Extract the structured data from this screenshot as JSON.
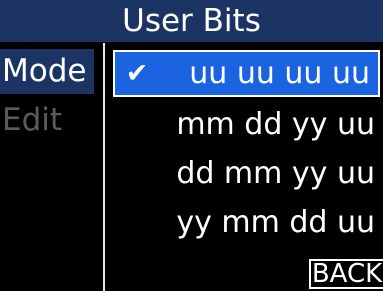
{
  "header": {
    "title": "User Bits"
  },
  "sidebar": {
    "items": [
      {
        "label": "Mode",
        "selected": true
      },
      {
        "label": "Edit",
        "selected": false
      }
    ]
  },
  "list": {
    "options": [
      {
        "label": "uu uu uu uu",
        "checked": true
      },
      {
        "label": "mm dd yy uu",
        "checked": false
      },
      {
        "label": "dd mm yy uu",
        "checked": false
      },
      {
        "label": "yy mm dd uu",
        "checked": false
      }
    ],
    "check_icon": "✔"
  },
  "footer": {
    "back_label": "BACK"
  },
  "colors": {
    "title_bg": "#1c3463",
    "selected_row_bg": "#1c63e2",
    "dim_text": "#5b5b5b"
  }
}
